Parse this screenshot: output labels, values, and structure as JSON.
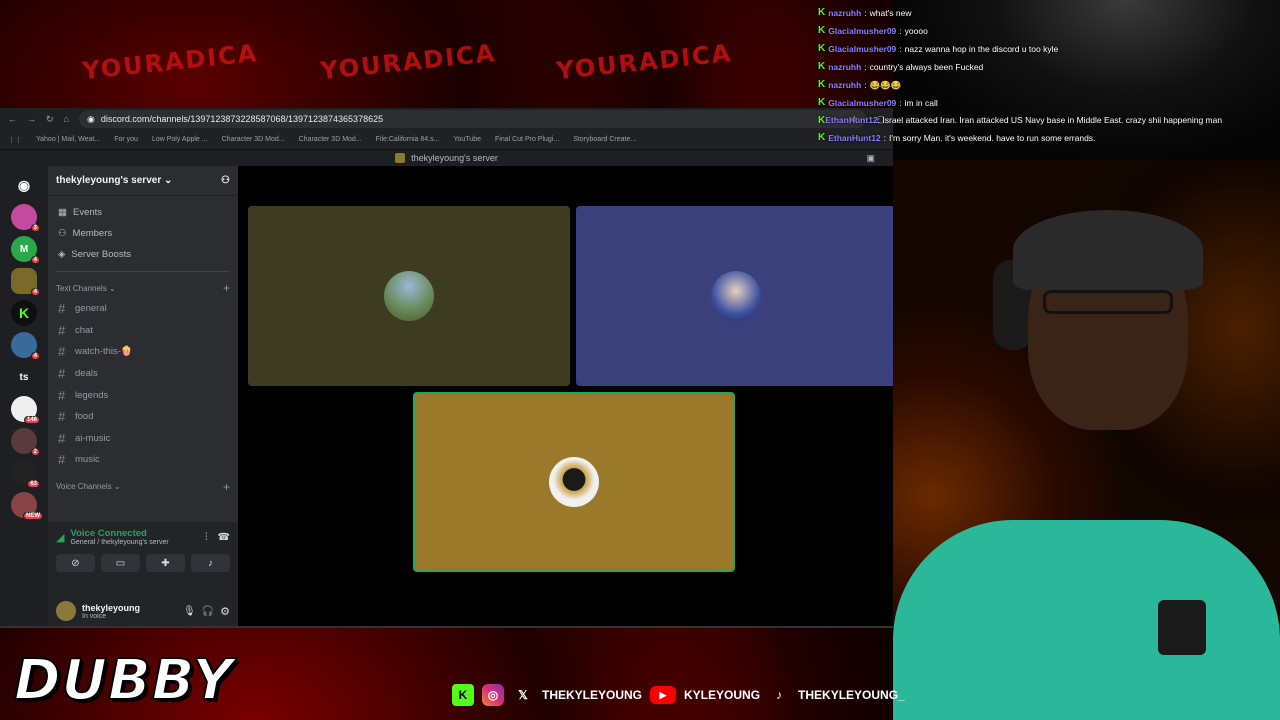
{
  "background": {
    "brand_text": "YOURADICA"
  },
  "browser": {
    "url": "discord.com/channels/1397123873228587068/1397123874365378625",
    "bookmarks": [
      "Yahoo | Mail, Weat...",
      "For you",
      "Low Poly Apple ...",
      "Character 3D Mod...",
      "Character 3D Mod...",
      "File:California 84.s...",
      "YouTube",
      "Final Cut Pro Plugi...",
      "Storyboard Create..."
    ],
    "tab_title": "thekyleyoung's server"
  },
  "discord": {
    "server_name": "thekyleyoung's server",
    "guilds": [
      {
        "label": "",
        "badge": "3",
        "color": "#c44aa0"
      },
      {
        "label": "M",
        "badge": "4",
        "color": "#2ba84a"
      },
      {
        "label": "",
        "badge": "4",
        "color": "#7a6a2a"
      },
      {
        "label": "K",
        "badge": "",
        "color": "#0f0f0f"
      },
      {
        "label": "",
        "badge": "4",
        "color": "#3a6a9a"
      },
      {
        "label": "ts",
        "badge": "",
        "color": "#1e1f22"
      },
      {
        "label": "",
        "badge": "146",
        "color": "#eeeeee"
      },
      {
        "label": "",
        "badge": "2",
        "color": "#5a3a3a"
      },
      {
        "label": "",
        "badge": "63",
        "color": "#222222"
      },
      {
        "label": "",
        "badge": "NEW",
        "color": "#884444"
      }
    ],
    "nav": {
      "events": "Events",
      "members": "Members",
      "boosts": "Server Boosts"
    },
    "text_category": "Text Channels",
    "channels": [
      "general",
      "chat",
      "watch-this-🍿",
      "deals",
      "legends",
      "food",
      "ai-music",
      "music"
    ],
    "voice_category": "Voice Channels",
    "voice_panel": {
      "title": "Voice Connected",
      "subtitle": "General / thekyleyoung's server"
    },
    "user": {
      "name": "thekyleyoung",
      "status": "In voice"
    },
    "tiles": [
      {
        "color": "#3d3b22"
      },
      {
        "color": "#3a4079"
      },
      {
        "color": "#9a7a2a"
      }
    ]
  },
  "chat": [
    {
      "user": "nazruhh",
      "text": "what's new"
    },
    {
      "user": "Glacialmusher09",
      "text": "yoooo"
    },
    {
      "user": "Glacialmusher09",
      "text": "nazz wanna hop in the discord u too kyle"
    },
    {
      "user": "nazruhh",
      "text": "country's always been Fucked"
    },
    {
      "user": "nazruhh",
      "text": "😂😂😂"
    },
    {
      "user": "Glacialmusher09",
      "text": "im in call"
    },
    {
      "user": "EthanHunt12",
      "text": "Israel attacked Iran. Iran attacked US Navy base in Middle East. crazy shii happening man"
    },
    {
      "user": "EthanHunt12",
      "text": "I'm sorry Man. it's weekend. have to run some errands."
    }
  ],
  "overlay": {
    "brand": "DUBBY",
    "socials": [
      {
        "icon": "kick-icon",
        "handle": ""
      },
      {
        "icon": "instagram-icon",
        "handle": ""
      },
      {
        "icon": "x-icon",
        "handle": "THEKYLEYOUNG"
      },
      {
        "icon": "youtube-icon",
        "handle": "KYLEYOUNG"
      },
      {
        "icon": "tiktok-icon",
        "handle": "THEKYLEYOUNG_"
      }
    ]
  },
  "colors": {
    "voice_green": "#23a55a",
    "kick_green": "#53fc18",
    "chat_username": "#8b7cff",
    "shirt": "#2ab79a"
  }
}
